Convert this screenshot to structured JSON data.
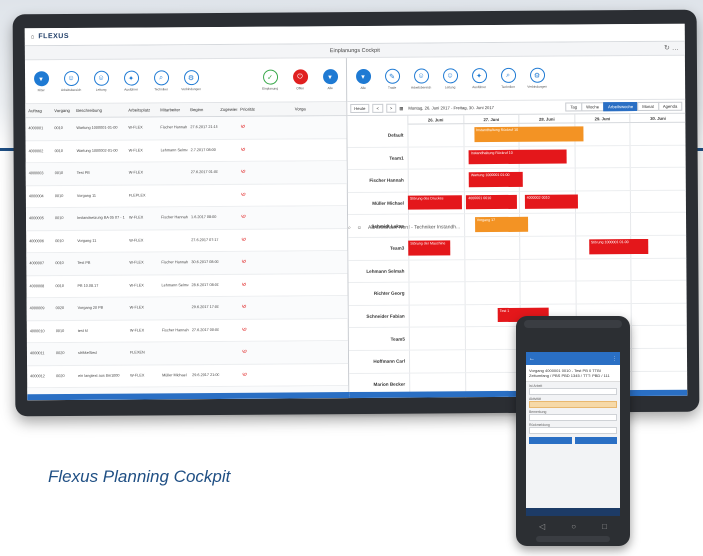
{
  "caption": "Flexus Planning Cockpit",
  "app": {
    "logo": "FLEXUS",
    "window_title": "Einplanungs Cockpit",
    "user": "Administrator Nord - Techniker Instandh..."
  },
  "left_toolbar": [
    {
      "icon": "filter-icon",
      "label": "Filter"
    },
    {
      "icon": "person-icon",
      "label": "Arbeitsbereich"
    },
    {
      "icon": "person-icon",
      "label": "Leitung"
    },
    {
      "icon": "bulb-icon",
      "label": "Ausführer"
    },
    {
      "icon": "person-search-icon",
      "label": "Techniker"
    },
    {
      "icon": "gear-icon",
      "label": "Verbindungen"
    }
  ],
  "left_toolbar_right": [
    {
      "icon": "check-icon",
      "label": "Einplanung",
      "color": "green"
    },
    {
      "icon": "stop-icon",
      "label": "Offen",
      "color": "red"
    },
    {
      "icon": "filter-icon",
      "label": "Alle",
      "color": "blue"
    }
  ],
  "table": {
    "headers": [
      "Auftrag",
      "Vorgang",
      "Beschreibung",
      "Arbeitsplatz",
      "Mitarbeiter",
      "Beginn",
      "Zugewiesen",
      "Priorität",
      "Vorga"
    ],
    "rows": [
      [
        "4000001",
        "0010",
        "Wartung 1000001-01-00",
        "W-FLEX",
        "Fischer Hannah",
        "27.6.2017 21:15"
      ],
      [
        "4000002",
        "0010",
        "Wartung 1000002-01-00",
        "W-FLEX",
        "Lehmann Selmah",
        "2.7.2017 08:00"
      ],
      [
        "4000003",
        "0010",
        "Test PB",
        "W-FLEX",
        "",
        "27.6.2017 01:00"
      ],
      [
        "4000004",
        "0010",
        "Vorgang 11",
        "FLEPLEX",
        "",
        ""
      ],
      [
        "4000005",
        "0010",
        "Instandsetzung BA 05 07 - 1",
        "W-FLEX",
        "Fischer Hannah",
        "1.6.2017 08:00"
      ],
      [
        "4000006",
        "0010",
        "Vorgang 11",
        "W-FLEX",
        "",
        "27.6.2017 07:17"
      ],
      [
        "4000007",
        "0010",
        "Test PB",
        "W-FLEX",
        "Fischer Hannah",
        "30.6.2017 08:00"
      ],
      [
        "4000008",
        "0010",
        "PB 10.08.17",
        "W-FLEX",
        "Lehmann Selmah",
        "28.6.2017 08:00"
      ],
      [
        "4000009",
        "0020",
        "Vorgang 20 PB",
        "W-FLEX",
        "",
        "29.6.2017 17:00"
      ],
      [
        "4000010",
        "0010",
        "test kl",
        "W-FLEX",
        "Fischer Hannah",
        "27.6.2017 00:00"
      ],
      [
        "4000011",
        "0020",
        "strikkeSiecl",
        "FLEXEN",
        "",
        ""
      ],
      [
        "4000012",
        "0020",
        "ein langtext aus 8m1000",
        "W-FLEX",
        "Müller Michael",
        "29.6.2017 21:00"
      ],
      [
        "4000013",
        "0040",
        "sdfsad",
        "W-FLEX",
        "",
        "29.6.2017 08:00"
      ]
    ]
  },
  "right_toolbar": [
    {
      "icon": "filter-icon",
      "label": "Alle"
    },
    {
      "icon": "pencil-icon",
      "label": "Trade"
    },
    {
      "icon": "person-icon",
      "label": "Arbeitsbereich"
    },
    {
      "icon": "person-icon",
      "label": "Leitung"
    },
    {
      "icon": "bulb-icon",
      "label": "Ausführer"
    },
    {
      "icon": "person-search-icon",
      "label": "Techniker"
    },
    {
      "icon": "gear-icon",
      "label": "Verbindungen"
    }
  ],
  "calendar": {
    "today": "Heute",
    "prev": "<",
    "next": ">",
    "range": "Montag, 26. Juni 2017 - Freitag, 30. Juni 2017",
    "views": [
      "Tag",
      "Woche",
      "Arbeitswoche",
      "Monat",
      "Agenda"
    ],
    "active_view": "Arbeitswoche",
    "days": [
      "26. Juni",
      "27. Juni",
      "28. Juni",
      "29. Juni",
      "30. Juni"
    ],
    "resources": [
      "Default",
      "Team1",
      "Fischer Hannah",
      "Müller Michael",
      "Schmidt Lukas",
      "Team3",
      "Lehmann Selmah",
      "Richter Georg",
      "Schneider Fabian",
      "Team5",
      "Hoffmann Carl",
      "Marion Becker"
    ],
    "events": [
      {
        "resource": 0,
        "day": 1.2,
        "span": 2.0,
        "text": "Instandhaltung Rückruf 10",
        "color": "orange"
      },
      {
        "resource": 1,
        "day": 1.1,
        "span": 1.8,
        "text": "Instandhaltung Rückruf 10",
        "color": "red"
      },
      {
        "resource": 2,
        "day": 1.1,
        "span": 1.0,
        "text": "Wartung 1000001 01-00",
        "color": "red"
      },
      {
        "resource": 3,
        "day": 0.0,
        "span": 1.0,
        "text": "Störung des Druckes",
        "color": "red"
      },
      {
        "resource": 3,
        "day": 1.05,
        "span": 0.95,
        "text": "4000001 0010",
        "color": "red"
      },
      {
        "resource": 3,
        "day": 2.1,
        "span": 1.0,
        "text": "4000002 0010",
        "color": "red"
      },
      {
        "resource": 4,
        "day": 1.2,
        "span": 1.0,
        "text": "Vorgang 17",
        "color": "orange"
      },
      {
        "resource": 5,
        "day": 0.0,
        "span": 0.8,
        "text": "Störung der Maschine",
        "color": "red"
      },
      {
        "resource": 5,
        "day": 3.25,
        "span": 1.1,
        "text": "Störung 1000001 01-00",
        "color": "red"
      },
      {
        "resource": 8,
        "day": 1.6,
        "span": 0.95,
        "text": "Test 1",
        "color": "red"
      }
    ]
  },
  "phone": {
    "title": "Vorgang 4000001 0010 - Test PB 0 TTBI",
    "subtitle": "Zeitumfang / PBS PBD 1345 / TTT: PBD / 111",
    "fields": [
      {
        "label": "Ist Arbeit",
        "value": ""
      },
      {
        "label": "Aktivität",
        "value": ""
      },
      {
        "label": "Bemerkung",
        "value": ""
      },
      {
        "label": "Rückmeldung",
        "value": ""
      }
    ]
  }
}
